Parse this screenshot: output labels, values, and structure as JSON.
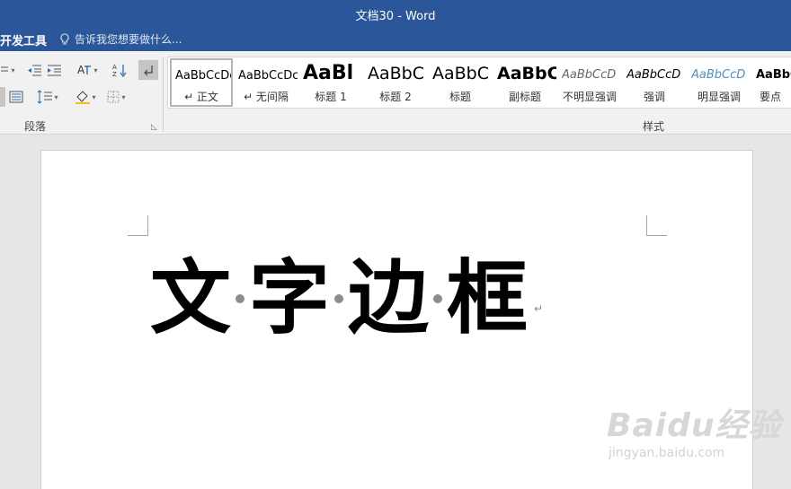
{
  "window": {
    "title": "文档30 - Word"
  },
  "tellbar": {
    "tab_label": "开发工具",
    "tell_me_placeholder": "告诉我您想要做什么..."
  },
  "ribbon": {
    "paragraph_group_label": "段落",
    "styles_group_label": "样式",
    "styles": [
      {
        "preview": "AaBbCcDc",
        "label": "↵ 正文",
        "selected": true
      },
      {
        "preview": "AaBbCcDc",
        "label": "↵ 无间隔"
      },
      {
        "preview": "AaBl",
        "label": "标题 1"
      },
      {
        "preview": "AaBbC",
        "label": "标题 2"
      },
      {
        "preview": "AaBbC",
        "label": "标题"
      },
      {
        "preview": "AaBbC",
        "label": "副标题"
      },
      {
        "preview": "AaBbCcD",
        "label": "不明显强调"
      },
      {
        "preview": "AaBbCcD",
        "label": "强调"
      },
      {
        "preview": "AaBbCcD",
        "label": "明显强调"
      },
      {
        "preview": "AaBbCc",
        "label": "要点"
      }
    ]
  },
  "document": {
    "characters": [
      "文",
      "字",
      "边",
      "框"
    ],
    "paragraph_mark": "↵"
  },
  "watermark": {
    "logo": "Baidu经验",
    "url": "jingyan.baidu.com"
  },
  "colors": {
    "title_bar": "#2b579a",
    "ribbon": "#f1f1f1",
    "canvas": "#e6e6e6",
    "page": "#ffffff",
    "emphasis_color": "#4a90c8"
  },
  "icons": [
    "lightbulb-icon",
    "bullets-icon",
    "decrease-indent-icon",
    "increase-indent-icon",
    "chinese-layout-icon",
    "sort-icon",
    "show-marks-icon",
    "distributed-align-icon",
    "line-spacing-icon",
    "shading-icon",
    "borders-icon",
    "dialog-launcher-icon"
  ]
}
